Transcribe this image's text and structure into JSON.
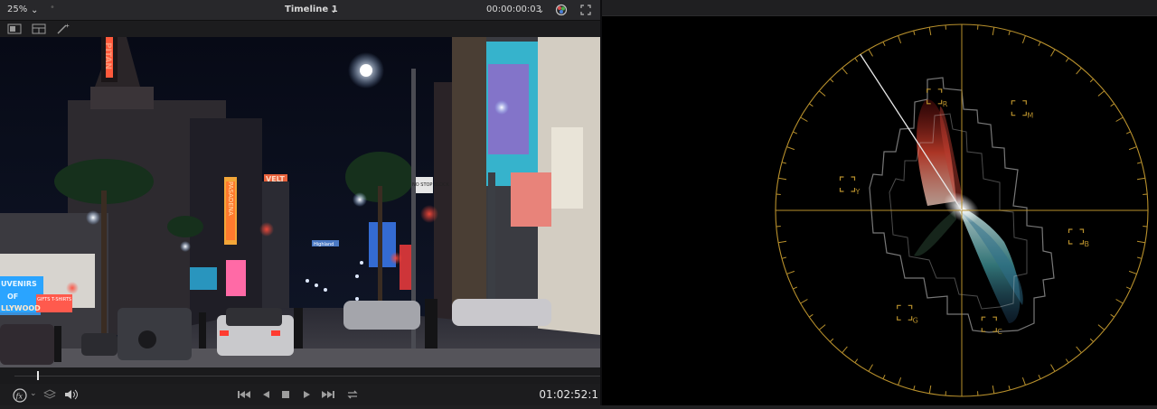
{
  "viewer": {
    "zoom": "25%",
    "timeline_name": "Timeline 1",
    "source_timecode": "00:00:00:03",
    "record_timecode": "01:02:52:1"
  },
  "scene_text": {
    "sign_pitan": "PITAN",
    "sign_pasadena": "PASADENA",
    "sign_velt": "VELT",
    "sign_no_stop": "NO STOP BLOCK",
    "sign_highland": "Highland",
    "sign_souvenirs": "UVENIRS",
    "sign_of": "OF",
    "sign_hollywood": "LLYWOOD",
    "sign_gifts": "GIFTS T-SHIRTS"
  },
  "vectorscope": {
    "targets": [
      {
        "label": "R"
      },
      {
        "label": "M"
      },
      {
        "label": "Y"
      },
      {
        "label": "B"
      },
      {
        "label": "G"
      },
      {
        "label": "C"
      }
    ],
    "graticule_color": "#b8902c",
    "skin_line_color": "#e8e8e8"
  }
}
